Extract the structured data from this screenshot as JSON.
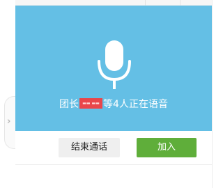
{
  "voice_card": {
    "prefix": "团长",
    "name_tag": "▬▬ ▬▬",
    "suffix": "等4人正在语音",
    "background_color": "#64bfe5",
    "icon": "microphone-icon"
  },
  "actions": {
    "end_call_label": "结束通话",
    "join_label": "加入",
    "join_color": "#5fae3a"
  },
  "sidebar": {
    "collapse_icon": "chevron-right-icon",
    "collapse_glyph": "›"
  }
}
